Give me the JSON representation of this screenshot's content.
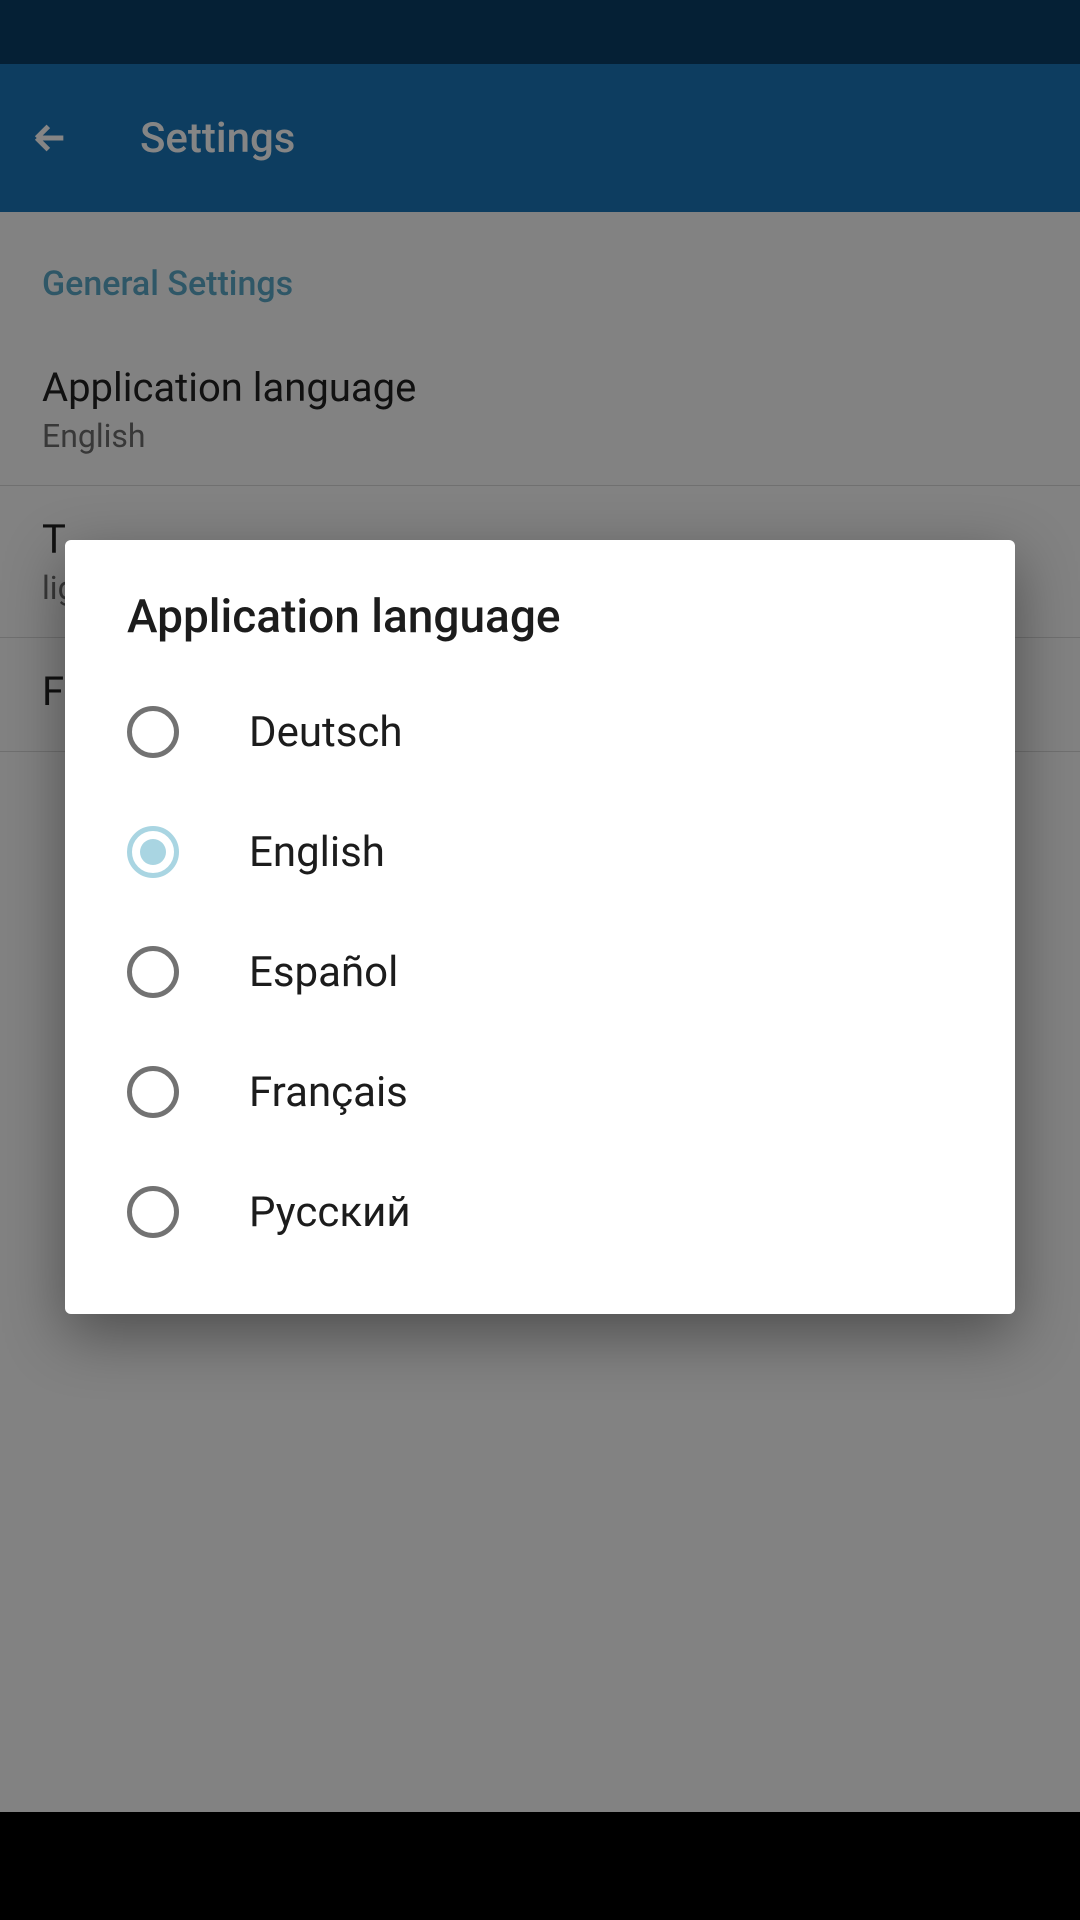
{
  "app_bar": {
    "title": "Settings"
  },
  "section": {
    "header": "General Settings"
  },
  "settings": {
    "app_language": {
      "title": "Application language",
      "value": "English"
    },
    "theme": {
      "title": "T",
      "value": "lig"
    },
    "font": {
      "title": "Fo"
    }
  },
  "dialog": {
    "title": "Application language",
    "options": [
      {
        "label": "Deutsch",
        "selected": false
      },
      {
        "label": "English",
        "selected": true
      },
      {
        "label": "Español",
        "selected": false
      },
      {
        "label": "Français",
        "selected": false
      },
      {
        "label": "Русский",
        "selected": false
      }
    ]
  }
}
